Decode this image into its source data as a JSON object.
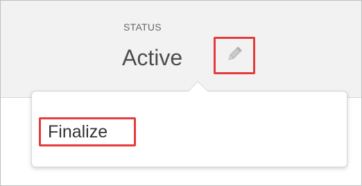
{
  "status": {
    "label": "STATUS",
    "value": "Active"
  },
  "edit": {
    "icon": "pencil-icon"
  },
  "popover": {
    "items": [
      {
        "label": "Finalize"
      }
    ]
  },
  "colors": {
    "highlight": "#e53b3b",
    "header_bg": "#f2f2f2",
    "text_dark": "#4d4d4d",
    "text_muted": "#666666"
  }
}
